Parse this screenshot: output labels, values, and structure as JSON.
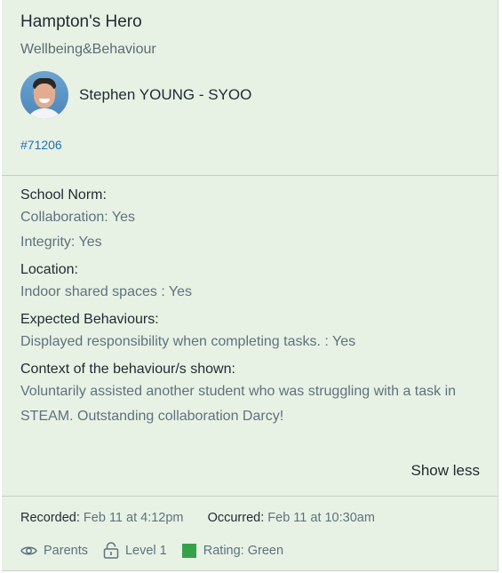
{
  "card": {
    "title": "Hampton's Hero",
    "category": "Wellbeing&Behaviour",
    "author": "Stephen YOUNG - SYOO",
    "reference": "#71206",
    "sections": [
      {
        "label": "School Norm:",
        "values": [
          "Collaboration: Yes",
          "Integrity: Yes"
        ]
      },
      {
        "label": "Location:",
        "values": [
          "Indoor shared spaces : Yes"
        ]
      },
      {
        "label": "Expected Behaviours:",
        "values": [
          "Displayed responsibility when completing tasks. : Yes"
        ]
      },
      {
        "label": "Context of the behaviour/s shown:",
        "values": [
          "Voluntarily assisted another student who was struggling with a task in STEAM. Outstanding collaboration Darcy!"
        ]
      }
    ],
    "show_less_label": "Show less",
    "recorded_key": "Recorded:",
    "recorded_value": " Feb 11 at 4:12pm",
    "occurred_key": "Occurred:",
    "occurred_value": " Feb 11 at 10:30am",
    "tags": {
      "visibility": "Parents",
      "level": "Level 1",
      "rating": "Rating: Green",
      "rating_color": "#35a24a"
    }
  }
}
